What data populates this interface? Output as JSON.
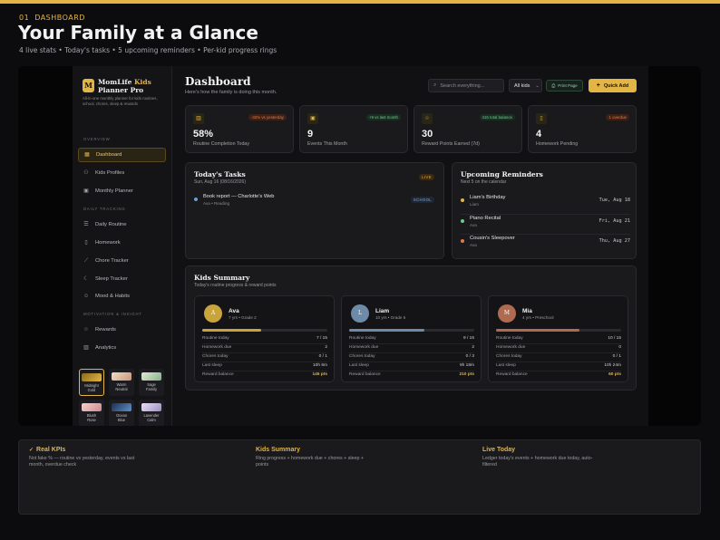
{
  "hero": {
    "section_number": "01",
    "section_label": "DASHBOARD",
    "title": "Your Family at a Glance",
    "subtitle": "4 live stats • Today's tasks • 5 upcoming reminders • Per-kid progress rings"
  },
  "sidebar": {
    "logo_letter": "M",
    "brand_line1": "MomLife",
    "brand_kids": "Kids",
    "brand_line2": "Planner Pro",
    "description": "All-in-one monthly planner for kids routines, school, chores, sleep & rewards",
    "sections": {
      "overview": "OVERVIEW",
      "daily": "DAILY TRACKING",
      "motivation": "MOTIVATION & INSIGHT"
    },
    "items": [
      {
        "label": "Dashboard",
        "icon": "grid-icon"
      },
      {
        "label": "Kids Profiles",
        "icon": "people-icon"
      },
      {
        "label": "Monthly Planner",
        "icon": "calendar-icon"
      },
      {
        "label": "Daily Routine",
        "icon": "checklist-icon"
      },
      {
        "label": "Homework",
        "icon": "document-icon"
      },
      {
        "label": "Chore Tracker",
        "icon": "broom-icon"
      },
      {
        "label": "Sleep Tracker",
        "icon": "moon-icon"
      },
      {
        "label": "Mood & Habits",
        "icon": "smile-icon"
      },
      {
        "label": "Rewards",
        "icon": "star-icon"
      },
      {
        "label": "Analytics",
        "icon": "bar-chart-icon"
      }
    ],
    "themes": [
      {
        "label1": "Midnight",
        "label2": "Gold",
        "color": "#c9a43a"
      },
      {
        "label1": "Warm",
        "label2": "Neutral",
        "color": "#e8c4a8"
      },
      {
        "label1": "Sage",
        "label2": "Family",
        "color": "#b8d4b0"
      },
      {
        "label1": "Blush",
        "label2": "Rose",
        "color": "#e8b0b0"
      },
      {
        "label1": "Ocean",
        "label2": "Blue",
        "color": "#6090c8"
      },
      {
        "label1": "Lavender",
        "label2": "Calm",
        "color": "#c0b0e0"
      }
    ]
  },
  "header": {
    "title": "Dashboard",
    "subtitle": "Here's how the family is doing this month.",
    "search_placeholder": "Search everything...",
    "kid_select": "All kids",
    "print_label": "Print Page",
    "quick_add_label": "Quick Add"
  },
  "kpis": [
    {
      "value": "58%",
      "label": "Routine Completion Today",
      "badge": "-33% vs yesterday",
      "badge_tone": "red",
      "icon": "bar-chart-icon"
    },
    {
      "value": "9",
      "label": "Events This Month",
      "badge": "+9 vs last month",
      "badge_tone": "green",
      "icon": "calendar-icon"
    },
    {
      "value": "30",
      "label": "Reward Points Earned (7d)",
      "badge": "415 total balance",
      "badge_tone": "green",
      "icon": "star-icon"
    },
    {
      "value": "4",
      "label": "Homework Pending",
      "badge": "1 overdue",
      "badge_tone": "red",
      "icon": "document-icon"
    }
  ],
  "tasks": {
    "title": "Today's Tasks",
    "date": "Sun, Aug 16 (08/16/2026)",
    "live": "LIVE",
    "items": [
      {
        "name": "Book report — Charlotte's Web",
        "meta": "Ava • Reading",
        "tag": "SCHOOL"
      }
    ]
  },
  "reminders": {
    "title": "Upcoming Reminders",
    "subtitle": "Next 5 on the calendar",
    "items": [
      {
        "name": "Liam's Birthday",
        "kid": "Liam",
        "date": "Tue, Aug 18",
        "color": "#e3b544"
      },
      {
        "name": "Piano Recital",
        "kid": "Ava",
        "date": "Fri, Aug 21",
        "color": "#6fc98e"
      },
      {
        "name": "Cousin's Sleepover",
        "kid": "Ava",
        "date": "Thu, Aug 27",
        "color": "#e27a4a"
      }
    ]
  },
  "kids_summary": {
    "title": "Kids Summary",
    "subtitle": "Today's routine progress & reward points",
    "row_labels": [
      "Routine today",
      "Homework due",
      "Chores today",
      "Last sleep",
      "Reward balance"
    ],
    "kids": [
      {
        "initial": "A",
        "name": "Ava",
        "meta": "7 yrs • Grade 2",
        "avatar_color": "#c9a43a",
        "bar_color": "#c9a43a",
        "progress": 0.47,
        "values": [
          "7 / 15",
          "2",
          "0 / 1",
          "10h 6m",
          "145 pts"
        ]
      },
      {
        "initial": "L",
        "name": "Liam",
        "meta": "10 yrs • Grade 5",
        "avatar_color": "#6d8aa8",
        "bar_color": "#6d8aa8",
        "progress": 0.6,
        "values": [
          "9 / 15",
          "2",
          "0 / 3",
          "9h 18m",
          "210 pts"
        ]
      },
      {
        "initial": "M",
        "name": "Mia",
        "meta": "4 yrs • Preschool",
        "avatar_color": "#b06a50",
        "bar_color": "#b06a50",
        "progress": 0.67,
        "values": [
          "10 / 15",
          "0",
          "0 / 1",
          "10h 24m",
          "60 pts"
        ]
      }
    ]
  },
  "footer": [
    {
      "title": "Real KPIs",
      "body": "Not fake % — routine vs yesterday, events vs last month, overdue check"
    },
    {
      "title": "Kids Summary",
      "body": "Ring progress + homework due + chores + sleep + points"
    },
    {
      "title": "Live Today",
      "body": "Ledger today's events + homework due today, auto-filtered"
    }
  ]
}
